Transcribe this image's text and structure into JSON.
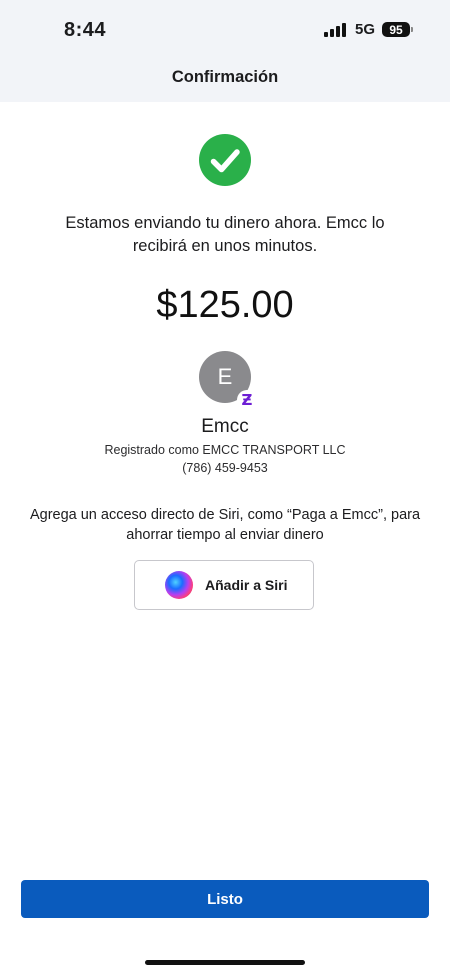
{
  "status_bar": {
    "time": "8:44",
    "network": "5G",
    "battery": "95"
  },
  "header": {
    "title": "Confirmación"
  },
  "confirmation": {
    "message": "Estamos enviando tu dinero ahora. Emcc lo recibirá en unos minutos.",
    "amount": "$125.00",
    "success_color": "#2ab04a"
  },
  "recipient": {
    "initial": "E",
    "name": "Emcc",
    "registered_as": "Registrado como EMCC TRANSPORT LLC",
    "phone": "(786) 459-9453",
    "badge_icon": "zelle-icon",
    "badge_glyph": "Ƶ",
    "badge_color": "#6d1ed4"
  },
  "siri": {
    "prompt": "Agrega un acceso directo de Siri, como “Paga a Emcc”, para ahorrar tiempo al enviar dinero",
    "button_label": "Añadir a Siri",
    "icon": "siri-icon"
  },
  "footer": {
    "done_label": "Listo",
    "button_color": "#0a5bbd"
  }
}
